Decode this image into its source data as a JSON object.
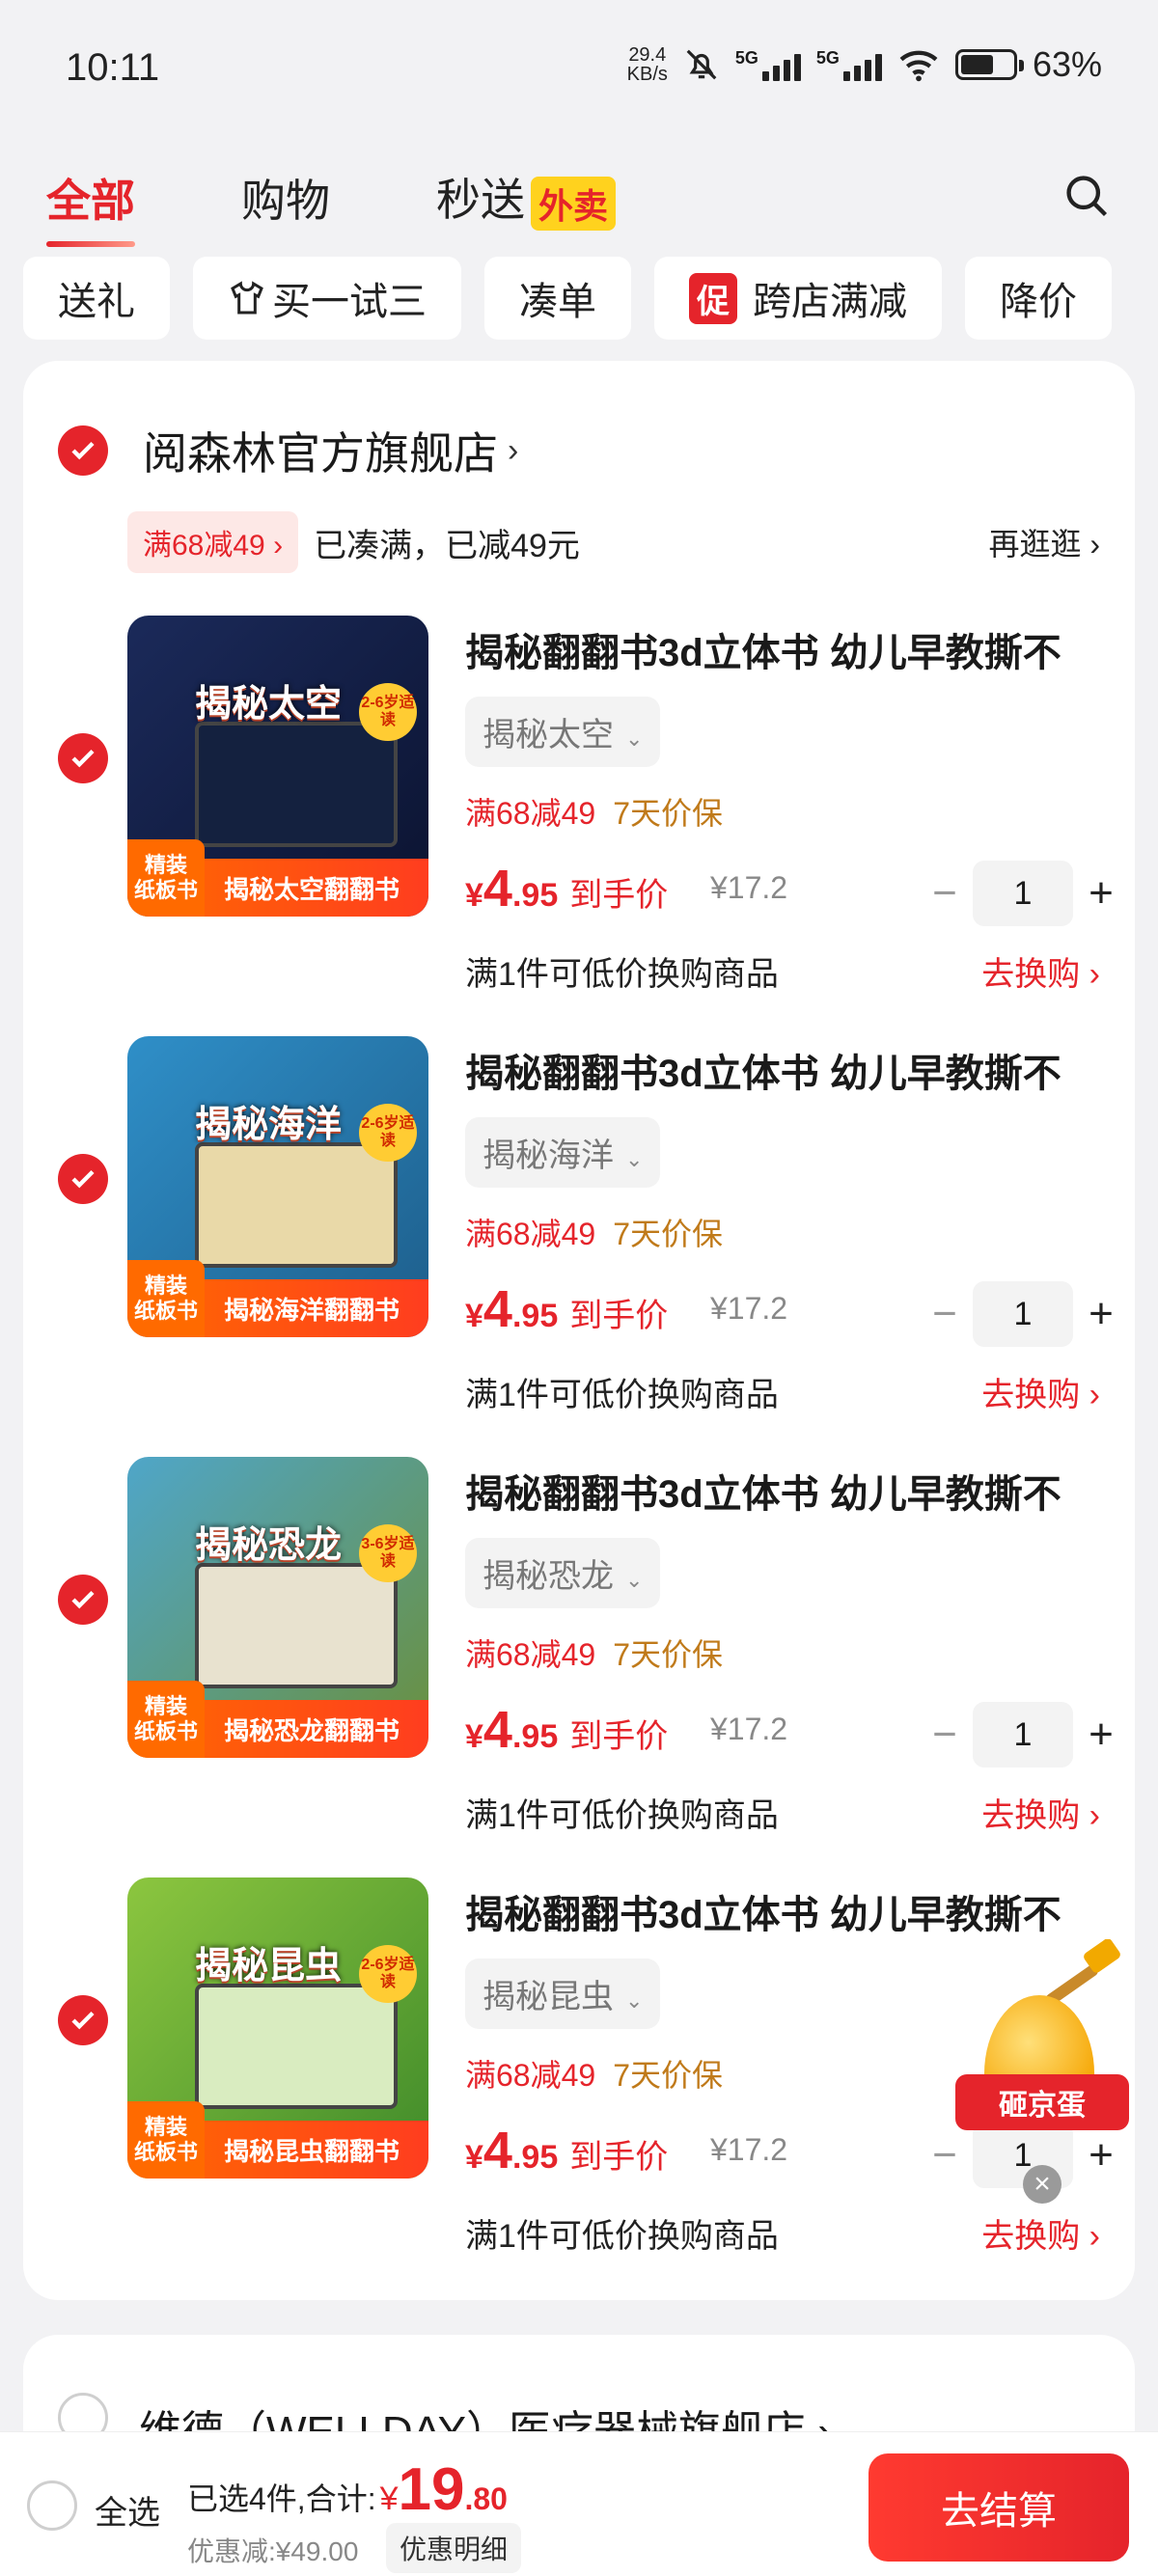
{
  "status": {
    "time": "10:11",
    "speed_value": "29.4",
    "speed_unit": "KB/s",
    "network": "5G",
    "battery": "63%"
  },
  "tabs": [
    {
      "label": "全部"
    },
    {
      "label": "购物"
    },
    {
      "label": "秒送",
      "badge": "外卖"
    }
  ],
  "chips": [
    "送礼",
    "买一试三",
    "凑单",
    "跨店满减",
    "降价"
  ],
  "chip_badge": "促",
  "store": {
    "name": "阅森林官方旗舰店",
    "promo_tag": "满68减49 ›",
    "promo_text": "已凑满，已减49元",
    "promo_more": "再逛逛 ›"
  },
  "items": [
    {
      "title": "揭秘翻翻书3d立体书 幼儿早教撕不",
      "spec": "揭秘太空",
      "tag1": "满68减49",
      "tag2": "7天价保",
      "price_cur": "¥",
      "price_int": "4",
      "price_dec": ".95",
      "price_label": "到手价",
      "orig_price": "¥17.2",
      "qty": "1",
      "exchange_text": "满1件可低价换购商品",
      "exchange_link": "去换购 ›",
      "book_title": "揭秘太空",
      "age": "2-6岁适读",
      "strip": "揭秘太空翻翻书",
      "badge1": "精装",
      "badge2": "纸板书",
      "bg1": "#1b2a5a",
      "bg2": "#0b1330"
    },
    {
      "title": "揭秘翻翻书3d立体书 幼儿早教撕不",
      "spec": "揭秘海洋",
      "tag1": "满68减49",
      "tag2": "7天价保",
      "price_cur": "¥",
      "price_int": "4",
      "price_dec": ".95",
      "price_label": "到手价",
      "orig_price": "¥17.2",
      "qty": "1",
      "exchange_text": "满1件可低价换购商品",
      "exchange_link": "去换购 ›",
      "book_title": "揭秘海洋",
      "age": "2-6岁适读",
      "strip": "揭秘海洋翻翻书",
      "badge1": "精装",
      "badge2": "纸板书",
      "bg1": "#2f8fc8",
      "bg2": "#1d5d8a"
    },
    {
      "title": "揭秘翻翻书3d立体书 幼儿早教撕不",
      "spec": "揭秘恐龙",
      "tag1": "满68减49",
      "tag2": "7天价保",
      "price_cur": "¥",
      "price_int": "4",
      "price_dec": ".95",
      "price_label": "到手价",
      "orig_price": "¥17.2",
      "qty": "1",
      "exchange_text": "满1件可低价换购商品",
      "exchange_link": "去换购 ›",
      "book_title": "揭秘恐龙",
      "age": "3-6岁适读",
      "strip": "揭秘恐龙翻翻书",
      "badge1": "精装",
      "badge2": "纸板书",
      "bg1": "#4fa6c9",
      "bg2": "#6b8f3a"
    },
    {
      "title": "揭秘翻翻书3d立体书 幼儿早教撕不",
      "spec": "揭秘昆虫",
      "tag1": "满68减49",
      "tag2": "7天价保",
      "price_cur": "¥",
      "price_int": "4",
      "price_dec": ".95",
      "price_label": "到手价",
      "orig_price": "¥17.2",
      "qty": "1",
      "exchange_text": "满1件可低价换购商品",
      "exchange_link": "去换购 ›",
      "book_title": "揭秘昆虫",
      "age": "2-6岁适读",
      "strip": "揭秘昆虫翻翻书",
      "badge1": "精装",
      "badge2": "纸板书",
      "bg1": "#8cc63f",
      "bg2": "#3f8a2a"
    }
  ],
  "store2": {
    "name": "维德（WELLDAY）医疗器械旗舰店 ›"
  },
  "egg": {
    "label": "砸京蛋"
  },
  "bottom": {
    "select_all": "全选",
    "summary": "已选4件,合计:",
    "total_cur": "¥",
    "total_int": "19",
    "total_dec": ".80",
    "discount": "优惠减:¥49.00",
    "detail": "优惠明细",
    "checkout": "去结算"
  },
  "colors": {
    "accent": "#e5242b",
    "page_bg": "#f2f2f4"
  }
}
